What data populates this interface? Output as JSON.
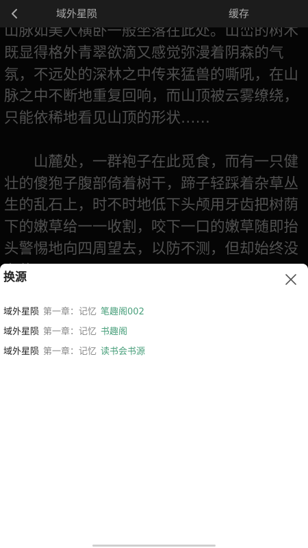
{
  "header": {
    "back_icon": "chevron-left-icon",
    "title": "域外星陨",
    "cache_label": "缓存"
  },
  "reader": {
    "paragraphs": [
      "山脉如美人横卧一般坐落在此处。山峦的树木既显得格外青翠欲滴又感觉弥漫着阴森的气氛，不远处的深林之中传来猛兽的嘶吼，在山脉之中不断地重复回响，而山顶被云雾缭绕，只能依稀地看见山顶的形状……",
      "山麓处，一群袍子在此觅食，而有一只健壮的傻狍子腹部倚着树干，蹄子轻踩着杂草丛生的乱石上，时不时地低下头颅用牙齿把树荫下的嫩草给一一收割，咬下一口的嫩草随即抬头警惕地向四周望去，以防不测，但却始终没有停"
    ]
  },
  "sheet": {
    "title": "换源",
    "close_icon": "close-icon",
    "sources": [
      {
        "book": "域外星陨",
        "chapter": "第一章：记忆",
        "source": "笔趣阁002"
      },
      {
        "book": "域外星陨",
        "chapter": "第一章：记忆",
        "source": "书趣阁"
      },
      {
        "book": "域外星陨",
        "chapter": "第一章：记忆",
        "source": "读书会书源"
      }
    ]
  },
  "colors": {
    "source_accent": "#4aa07c",
    "topbar_bg": "#222222",
    "reader_bg": "#070707",
    "reader_text": "#5e5e5e"
  }
}
